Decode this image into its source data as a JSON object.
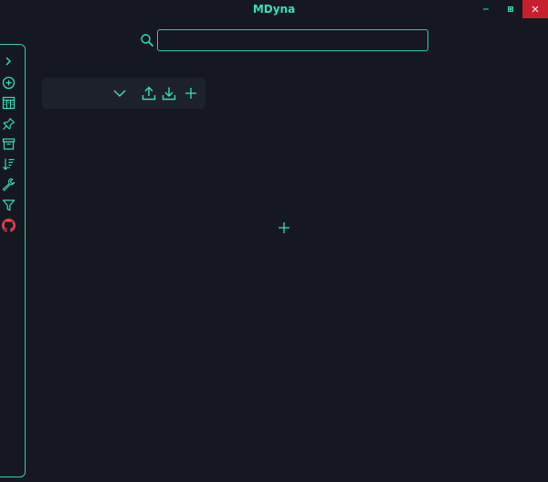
{
  "app": {
    "title": "MDyna",
    "accent_color": "#37e0b0",
    "background_color": "#151820",
    "github_color": "#e0404f",
    "close_button_color": "#c5202c"
  },
  "window_controls": {
    "minimize_icon": "minimize-icon",
    "maximize_icon": "maximize-icon",
    "close_icon": "close-icon"
  },
  "search": {
    "value": "",
    "placeholder": "",
    "icon": "search-icon"
  },
  "sidebar": {
    "items": [
      {
        "id": "expand",
        "icon": "chevron-right-icon"
      },
      {
        "id": "add-note",
        "icon": "plus-circle-icon"
      },
      {
        "id": "board",
        "icon": "board-icon"
      },
      {
        "id": "pin",
        "icon": "pin-icon"
      },
      {
        "id": "archive",
        "icon": "archive-icon"
      },
      {
        "id": "sort",
        "icon": "sort-icon"
      },
      {
        "id": "settings",
        "icon": "wrench-icon"
      },
      {
        "id": "filter",
        "icon": "filter-icon"
      },
      {
        "id": "github",
        "icon": "github-icon"
      }
    ]
  },
  "card": {
    "actions": [
      {
        "id": "collapse",
        "icon": "chevron-down-icon"
      },
      {
        "id": "export",
        "icon": "upload-icon"
      },
      {
        "id": "import",
        "icon": "download-icon"
      },
      {
        "id": "add",
        "icon": "plus-icon"
      }
    ]
  },
  "main": {
    "add_icon": "plus-icon"
  }
}
